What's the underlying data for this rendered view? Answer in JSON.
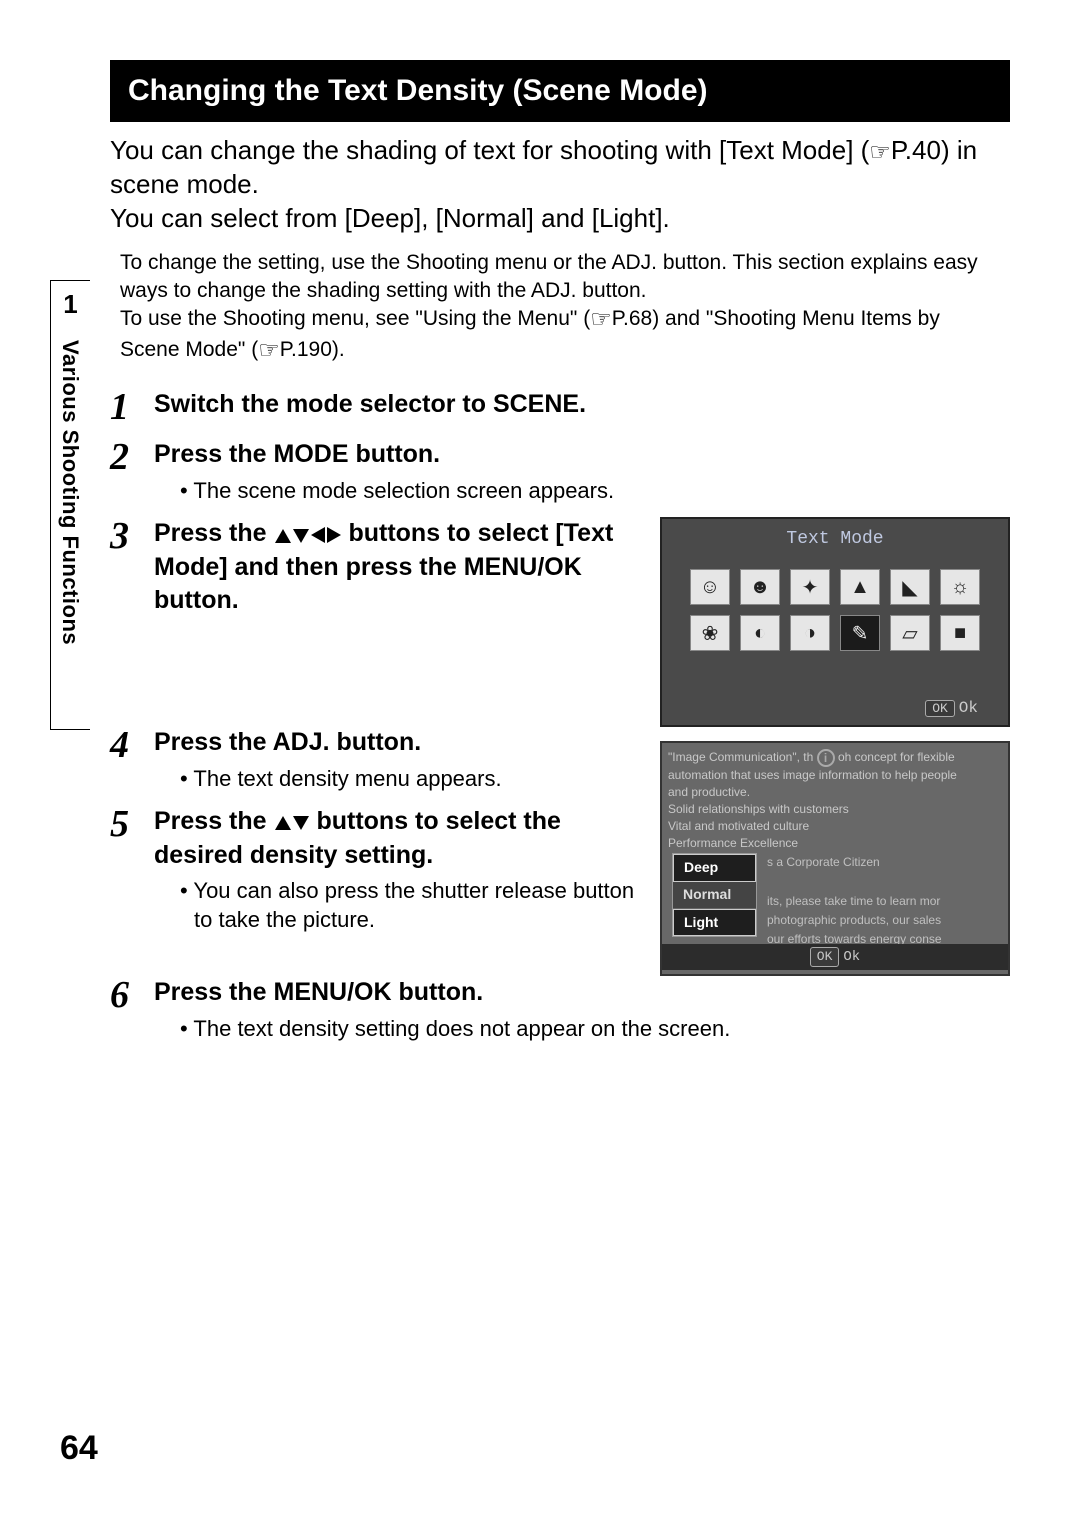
{
  "side": {
    "chapter_num": "1",
    "chapter_title": "Various Shooting Functions"
  },
  "header": "Changing the Text Density (Scene Mode)",
  "intro": {
    "line1a": "You can change the shading of text for shooting with [Text Mode] (",
    "ref1": "P.40",
    "line1b": ") in scene mode.",
    "line2": "You can select from [Deep], [Normal] and [Light]."
  },
  "note": {
    "p1": "To change the setting, use the Shooting menu or the ADJ. button. This section explains easy ways to change the shading setting with the ADJ. button.",
    "p2a": "To use the Shooting menu, see \"Using the Menu\" (",
    "ref2": "P.68",
    "p2b": ") and \"Shooting Menu Items by Scene Mode\" (",
    "ref3": "P.190",
    "p2c": ")."
  },
  "steps": {
    "s1": {
      "num": "1",
      "title": "Switch the mode selector to SCENE."
    },
    "s2": {
      "num": "2",
      "title": "Press the MODE button.",
      "bullet": "The scene mode selection screen appears."
    },
    "s3": {
      "num": "3",
      "title_a": "Press the ",
      "title_b": " buttons to select [Text Mode] and then press the MENU/OK button."
    },
    "s4": {
      "num": "4",
      "title": "Press the ADJ. button.",
      "bullet": "The text density menu appears."
    },
    "s5": {
      "num": "5",
      "title_a": "Press the ",
      "title_b": " buttons to select the desired density setting.",
      "bullet": "You can also press the shutter release button to take the picture."
    },
    "s6": {
      "num": "6",
      "title": "Press the MENU/OK button.",
      "bullet": "The text density setting does not appear on the screen."
    }
  },
  "screen1": {
    "title": "Text Mode",
    "ok_badge": "OK",
    "ok_text": "Ok"
  },
  "screen2": {
    "line1a": "\"Image Communication\", th",
    "line1b": "oh concept for flexible",
    "line2": "automation that uses image information to help people",
    "line3": "and productive.",
    "line4": "Solid relationships with customers",
    "line5": "Vital and motivated culture",
    "line6": "Performance Excellence",
    "right1": "s a Corporate Citizen",
    "right2": "its, please take time to learn mor",
    "right3": "photographic products, our sales",
    "right4": "our efforts towards energy conse",
    "density": {
      "deep": "Deep",
      "normal": "Normal",
      "light": "Light"
    },
    "ok_badge": "OK",
    "ok_text": "Ok"
  },
  "page_number": "64"
}
